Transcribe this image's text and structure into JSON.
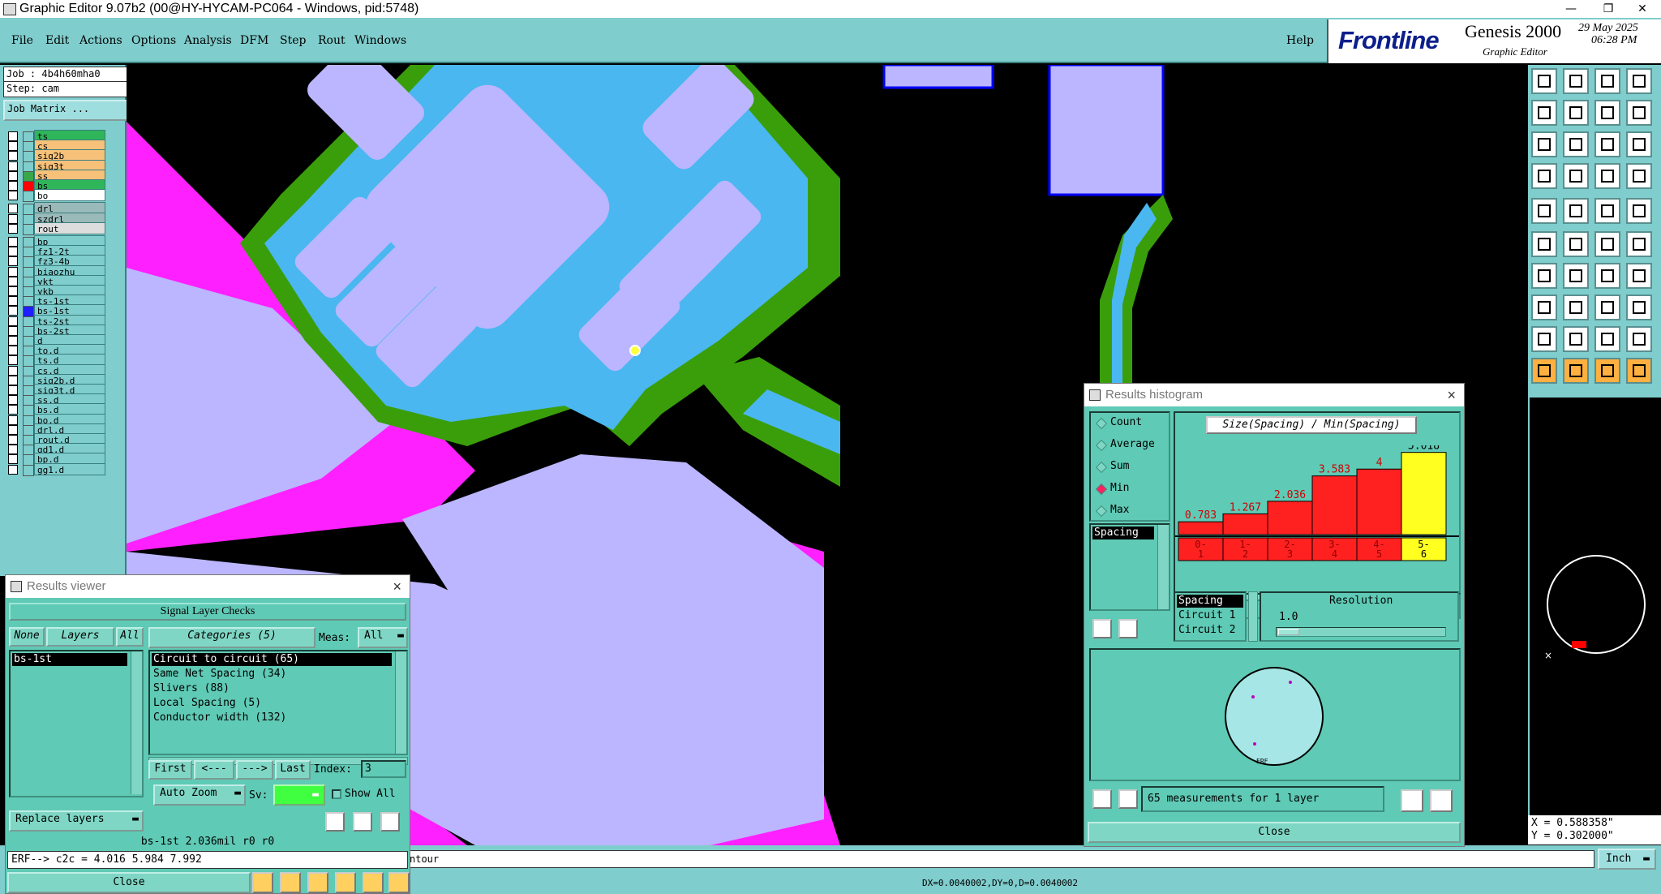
{
  "window": {
    "title": "Graphic Editor 9.07b2 (00@HY-HYCAM-PC064 - Windows, pid:5748)",
    "minimize": "—",
    "restore": "❐",
    "close": "✕"
  },
  "menu": {
    "items": [
      "File",
      "Edit",
      "Actions",
      "Options",
      "Analysis",
      "DFM",
      "Step",
      "Rout",
      "Windows"
    ],
    "help": "Help"
  },
  "brand": {
    "logo_a": "Front",
    "logo_b": "line",
    "product": "Genesis 2000",
    "subtitle": "Graphic Editor",
    "date": "29 May 2025",
    "time": "06:28 PM"
  },
  "job": {
    "job_label": "Job : 4b4h60mha0",
    "step_label": "Step: cam",
    "matrix_button": "Job Matrix ..."
  },
  "layers": [
    {
      "name": "ts",
      "color": "#2fb55a",
      "swatch": "#7fcdcd"
    },
    {
      "name": "cs",
      "color": "#f7c17a",
      "swatch": "#7fcdcd"
    },
    {
      "name": "sig2b",
      "color": "#f7c17a",
      "swatch": "#7fcdcd"
    },
    {
      "name": "sig3t",
      "color": "#f7c17a",
      "swatch": "#7fcdcd"
    },
    {
      "name": "ss",
      "color": "#f7c17a",
      "swatch": "#3aa64a"
    },
    {
      "name": "bs",
      "color": "#2fb55a",
      "swatch": "#ff0000"
    },
    {
      "name": "bo",
      "color": "#ffffff",
      "swatch": "#7fcdcd"
    },
    {
      "name": "drl",
      "color": "#9ababa",
      "swatch": "#7fcdcd"
    },
    {
      "name": "szdrl",
      "color": "#9ababa",
      "swatch": "#7fcdcd"
    },
    {
      "name": "rout",
      "color": "#dddddd",
      "swatch": "#7fcdcd"
    },
    {
      "name": "bp",
      "color": "#7fcdcd",
      "swatch": "#7fcdcd"
    },
    {
      "name": "fz1-2t",
      "color": "#7fcdcd",
      "swatch": "#7fcdcd"
    },
    {
      "name": "fz3-4b",
      "color": "#7fcdcd",
      "swatch": "#7fcdcd"
    },
    {
      "name": "biaozhu",
      "color": "#7fcdcd",
      "swatch": "#7fcdcd"
    },
    {
      "name": "ykt",
      "color": "#7fcdcd",
      "swatch": "#7fcdcd"
    },
    {
      "name": "ykb",
      "color": "#7fcdcd",
      "swatch": "#7fcdcd"
    },
    {
      "name": "ts-1st",
      "color": "#7fcdcd",
      "swatch": "#7fcdcd"
    },
    {
      "name": "bs-1st",
      "color": "#7fcdcd",
      "swatch": "#1f1fff"
    },
    {
      "name": "ts-2st",
      "color": "#7fcdcd",
      "swatch": "#7fcdcd"
    },
    {
      "name": "bs-2st",
      "color": "#7fcdcd",
      "swatch": "#7fcdcd"
    },
    {
      "name": "d",
      "color": "#7fcdcd",
      "swatch": "#7fcdcd"
    },
    {
      "name": "to.d",
      "color": "#7fcdcd",
      "swatch": "#7fcdcd"
    },
    {
      "name": "ts.d",
      "color": "#7fcdcd",
      "swatch": "#7fcdcd"
    },
    {
      "name": "cs.d",
      "color": "#7fcdcd",
      "swatch": "#7fcdcd"
    },
    {
      "name": "sig2b.d",
      "color": "#7fcdcd",
      "swatch": "#7fcdcd"
    },
    {
      "name": "sig3t.d",
      "color": "#7fcdcd",
      "swatch": "#7fcdcd"
    },
    {
      "name": "ss.d",
      "color": "#7fcdcd",
      "swatch": "#7fcdcd"
    },
    {
      "name": "bs.d",
      "color": "#7fcdcd",
      "swatch": "#7fcdcd"
    },
    {
      "name": "bo.d",
      "color": "#7fcdcd",
      "swatch": "#7fcdcd"
    },
    {
      "name": "drl.d",
      "color": "#7fcdcd",
      "swatch": "#7fcdcd"
    },
    {
      "name": "rout.d",
      "color": "#7fcdcd",
      "swatch": "#7fcdcd"
    },
    {
      "name": "gd1.d",
      "color": "#7fcdcd",
      "swatch": "#7fcdcd"
    },
    {
      "name": "bp.d",
      "color": "#7fcdcd",
      "swatch": "#7fcdcd"
    },
    {
      "name": "gg1.d",
      "color": "#7fcdcd",
      "swatch": "#7fcdcd"
    }
  ],
  "results_viewer": {
    "title": "Results viewer",
    "header": "Signal Layer Checks",
    "none": "None",
    "layers": "Layers",
    "all": "All",
    "categories": "Categories (5)",
    "meas_label": "Meas:",
    "meas_value": "All",
    "layer_list": [
      "bs-1st"
    ],
    "category_list": [
      "Circuit to circuit (65)",
      "Same Net Spacing (34)",
      "Slivers (88)",
      "Local Spacing (5)",
      "Conductor width (132)"
    ],
    "first": "First",
    "prev": "<---",
    "next": "--->",
    "last": "Last",
    "index_label": "Index:",
    "index_value": "3",
    "auto_zoom": "Auto Zoom",
    "sv_label": "Sv:",
    "show_all": "Show All",
    "replace_layers": "Replace layers",
    "status": "bs-1st 2.036mil  r0  r0",
    "erf": "ERF--> c2c = 4.016 5.984 7.992",
    "close": "Close"
  },
  "histogram": {
    "title": "Results histogram",
    "options": [
      "Count",
      "Average",
      "Sum",
      "Min",
      "Max"
    ],
    "selected_option": "Min",
    "heading": "Size(Spacing) / Min(Spacing)",
    "list_items": [
      "Spacing"
    ],
    "bottom_list": [
      "Spacing",
      "Circuit 1",
      "Circuit 2"
    ],
    "resolution_label": "Resolution",
    "resolution_value": "1.0",
    "measurements": "65 measurements for 1 layer",
    "close": "Close"
  },
  "chart_data": {
    "type": "bar",
    "title": "Size(Spacing) / Min(Spacing)",
    "categories": [
      "0-1",
      "1-2",
      "2-3",
      "3-4",
      "4-5",
      "5-6"
    ],
    "values": [
      0.783,
      1.267,
      2.036,
      3.583,
      4,
      5.018
    ],
    "labels": [
      "0.783",
      "1.267",
      "2.036",
      "3.583",
      "4",
      "5.018"
    ],
    "colors": [
      "#ff2020",
      "#ff2020",
      "#ff2020",
      "#ff2020",
      "#ff2020",
      "#ffff20"
    ],
    "ylim": [
      0,
      5.2
    ]
  },
  "coords": {
    "x": "X = 0.588358\"",
    "y": "Y = 0.302000\""
  },
  "command_bar": {
    "text": "ntour",
    "unit": "Inch"
  },
  "status_bar": {
    "text": "DX=0.0040002,DY=0,D=0.0040002"
  },
  "colors": {
    "panel": "#7fcdcd",
    "dialog": "#5fcab5",
    "lavender": "#bbb6ff",
    "cyan": "#4ab7f0",
    "green": "#3a9e0a",
    "magenta": "#ff20ff",
    "bar_red": "#ff2020",
    "bar_yellow": "#ffff20"
  }
}
